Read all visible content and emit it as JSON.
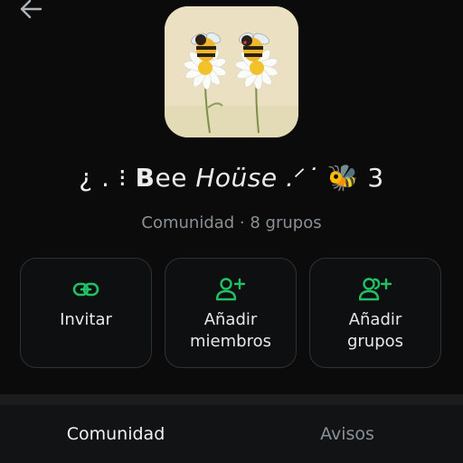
{
  "header": {
    "back_icon": "arrow-left-icon"
  },
  "group": {
    "avatar_icon": "bees-on-daisies-image",
    "title_prefix": "¿ . ⁝ ",
    "title_bold": "B",
    "title_mid": "ee ",
    "title_italic": "Ho",
    "title_u": "ü",
    "title_rest": "se .ᐟ˙ ",
    "title_emoji": "🐝",
    "title_suffix": " 3",
    "subtitle": "Comunidad · 8 grupos"
  },
  "actions": [
    {
      "label": "Invitar",
      "icon": "link-icon"
    },
    {
      "label": "Añadir\nmiembros",
      "icon": "add-person-icon"
    },
    {
      "label": "Añadir\ngrupos",
      "icon": "add-group-icon"
    }
  ],
  "tabs": [
    {
      "label": "Comunidad",
      "active": true
    },
    {
      "label": "Avisos",
      "active": false
    }
  ],
  "colors": {
    "accent": "#21c063",
    "background": "#0b0b0b"
  }
}
